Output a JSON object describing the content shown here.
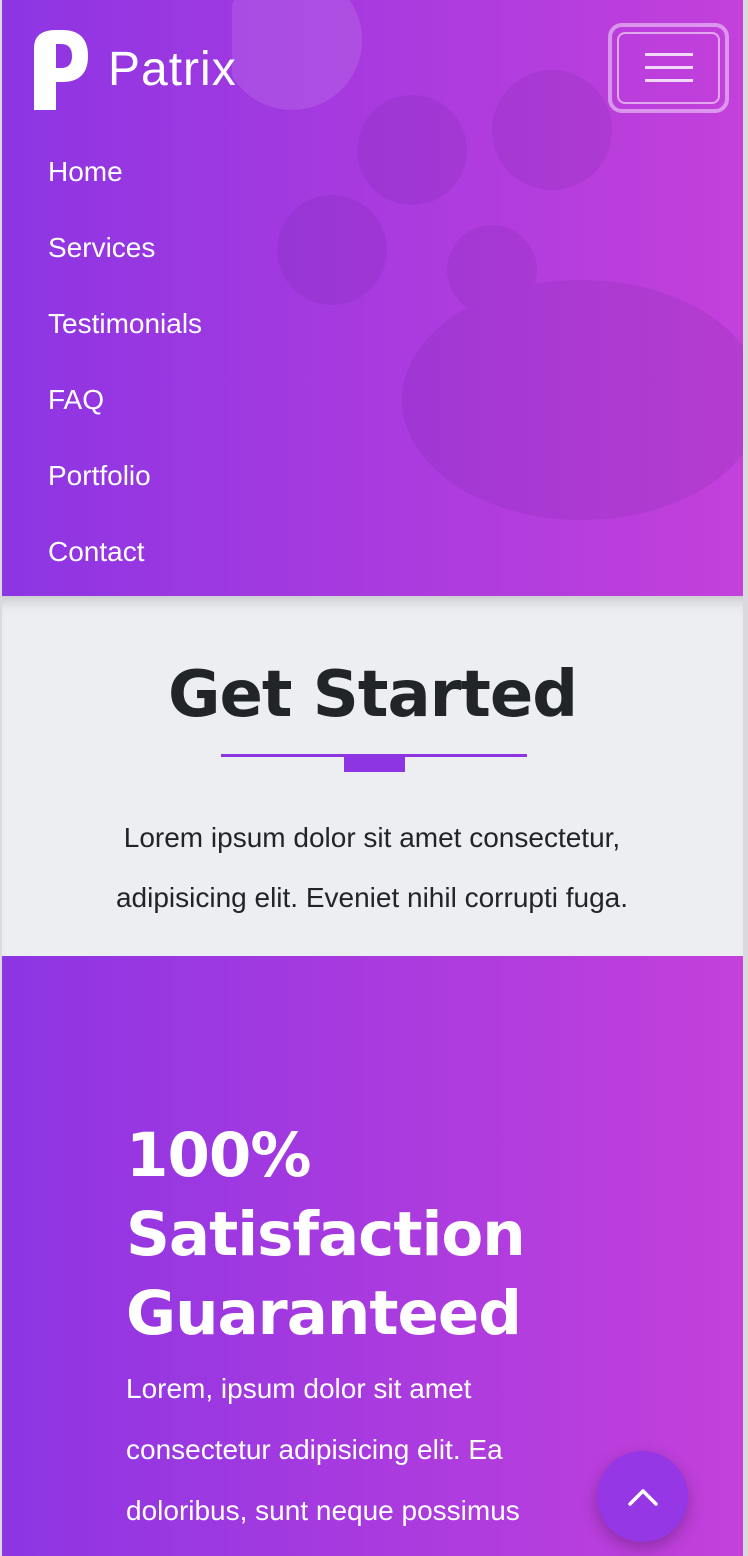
{
  "brand": {
    "name": "Patrix",
    "logo_icon": "patrix-p-logo"
  },
  "header": {
    "menu_toggle_icon": "hamburger-icon"
  },
  "nav": {
    "items": [
      {
        "label": "Home"
      },
      {
        "label": "Services"
      },
      {
        "label": "Testimonials"
      },
      {
        "label": "FAQ"
      },
      {
        "label": "Portfolio"
      },
      {
        "label": "Contact"
      }
    ]
  },
  "get_started": {
    "title": "Get Started",
    "text": "Lorem ipsum dolor sit amet consectetur, adipisicing elit. Eveniet nihil corrupti fuga."
  },
  "satisfaction": {
    "title": "100% Satisfaction Guaranteed",
    "text": "Lorem, ipsum dolor sit amet consectetur adipisicing elit. Ea doloribus, sunt neque possimus"
  },
  "back_to_top": {
    "icon": "chevron-up-icon"
  },
  "colors": {
    "gradient_start": "#8d35e3",
    "gradient_end": "#c340db",
    "accent": "#8d35e3",
    "section_bg": "#eceef2",
    "dark_text": "#222527"
  }
}
